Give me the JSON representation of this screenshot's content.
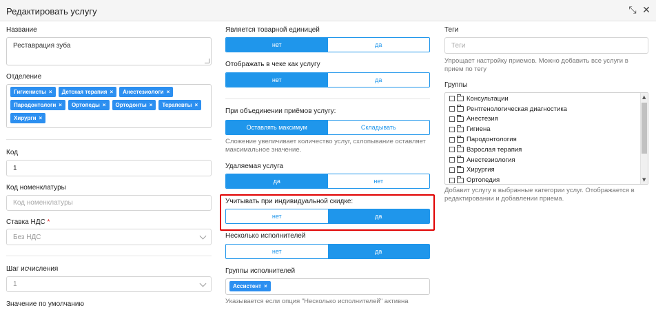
{
  "window": {
    "title": "Редактировать услугу"
  },
  "left": {
    "name_label": "Название",
    "name_value": "Реставрация зуба",
    "department_label": "Отделение",
    "departments": [
      "Гигиенисты",
      "Детская терапия",
      "Анестезиологи",
      "Пародонтологи",
      "Ортопеды",
      "Ортодонты",
      "Терапевты",
      "Хирурги"
    ],
    "code_label": "Код",
    "code_value": "1",
    "nomenclature_label": "Код номенклатуры",
    "nomenclature_placeholder": "Код номенклатуры",
    "vat_label": "Ставка НДС",
    "vat_required": "*",
    "vat_value": "Без НДС",
    "step_label": "Шаг исчисления",
    "step_value": "1",
    "default_label": "Значение по умолчанию"
  },
  "middle": {
    "commodity": {
      "label": "Является товарной единицей",
      "no": "нет",
      "yes": "да",
      "selected": "нет"
    },
    "receipt": {
      "label": "Отображать в чеке как услугу",
      "no": "нет",
      "yes": "да",
      "selected": "нет"
    },
    "merge": {
      "label": "При объединении приёмов услугу:",
      "max": "Оставлять максимум",
      "fold": "Складывать",
      "selected": "Оставлять максимум",
      "hint": "Сложение увеличивает количество услуг, схлопывание оставляет максимальное значение."
    },
    "removable": {
      "label": "Удаляемая услуга",
      "yes": "да",
      "no": "нет",
      "selected": "да"
    },
    "individual_discount": {
      "label": "Учитывать при индивидуальной скидке:",
      "no": "нет",
      "yes": "да",
      "selected": "да"
    },
    "multiple_performers": {
      "label": "Несколько исполнителей",
      "no": "нет",
      "yes": "да",
      "selected": "да"
    },
    "performer_groups": {
      "label": "Группы исполнителей",
      "tags": [
        "Ассистент"
      ],
      "hint": "Указывается если опция \"Несколько исполнителей\" активна"
    }
  },
  "right": {
    "tags_label": "Теги",
    "tags_placeholder": "Теги",
    "tags_hint": "Упрощает настройку приемов. Можно добавить все услуги в прием по тегу",
    "groups_label": "Группы",
    "groups": [
      "Консультации",
      "Рентгенологическая диагностика",
      "Анестезия",
      "Гигиена",
      "Пародонтология",
      "Взрослая терапия",
      "Анестезиология",
      "Хирургия",
      "Ортопедия"
    ],
    "groups_hint": "Добавит услугу в выбранные категории услуг. Отображается в редактировании и добавлении приема."
  },
  "icons": {
    "collapse": "collapse-arrows-icon",
    "close": "close-icon"
  },
  "colors": {
    "accent": "#1f96eb",
    "tag": "#2c8ff0",
    "highlight": "#e00000"
  }
}
